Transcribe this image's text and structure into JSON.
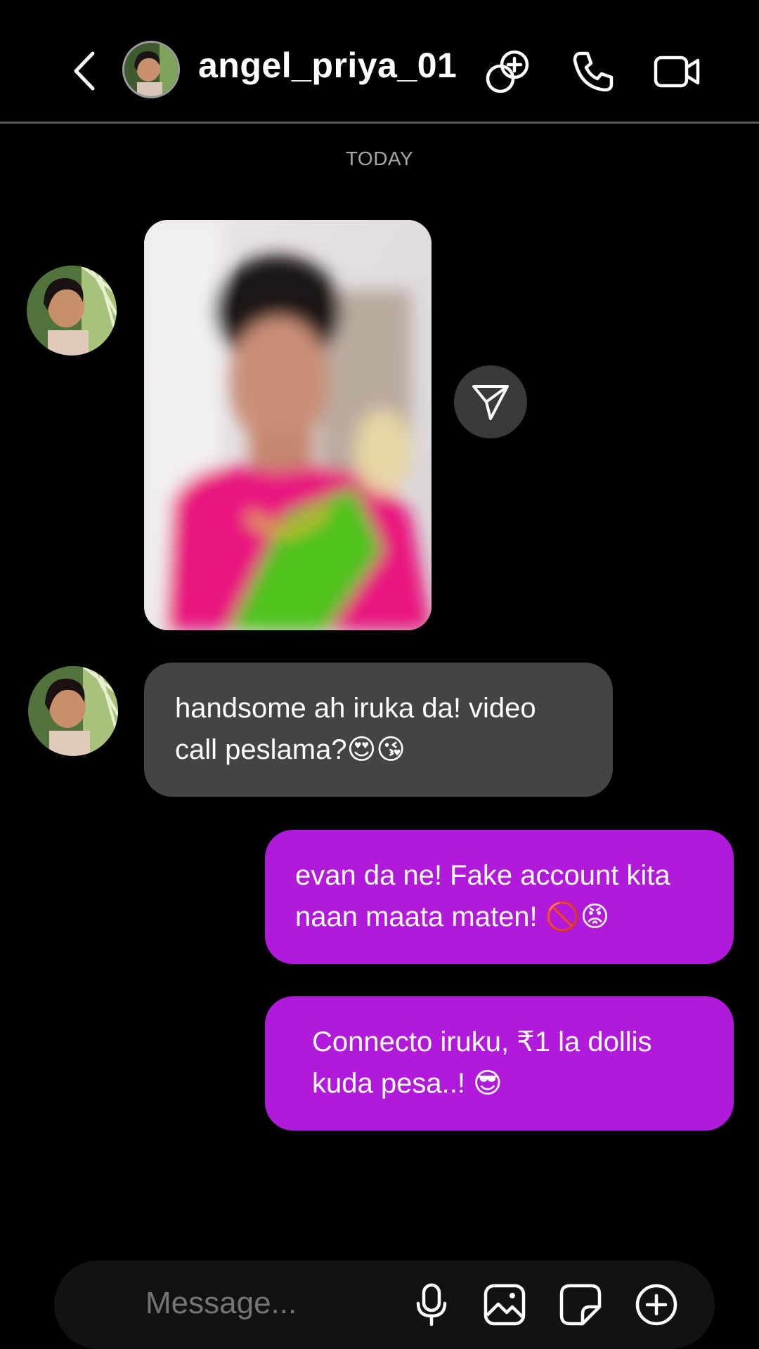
{
  "header": {
    "username": "angel_priya_01",
    "icons": [
      "back-arrow-icon",
      "avatar",
      "add-member-icon",
      "phone-icon",
      "video-camera-icon"
    ]
  },
  "thread": {
    "date_label": "TODAY",
    "messages": [
      {
        "from": "them",
        "type": "photo"
      },
      {
        "from": "them",
        "type": "text",
        "line1": "handsome ah iruka da! video",
        "line2": "call peslama?😍😘"
      },
      {
        "from": "me",
        "type": "text",
        "line1": "evan da ne! Fake account kita",
        "line2": "naan maata maten! 🚫😡"
      },
      {
        "from": "me",
        "type": "text",
        "line1": "Connecto iruku, ₹1 la dollis",
        "line2": "kuda pesa..! 😎"
      }
    ]
  },
  "composer": {
    "placeholder": "Message...",
    "icons": [
      "microphone-icon",
      "gallery-icon",
      "sticker-icon",
      "plus-icon"
    ]
  },
  "colors": {
    "outgoing_bubble": "#b21adb",
    "incoming_bubble": "#444444",
    "background": "#000000"
  }
}
